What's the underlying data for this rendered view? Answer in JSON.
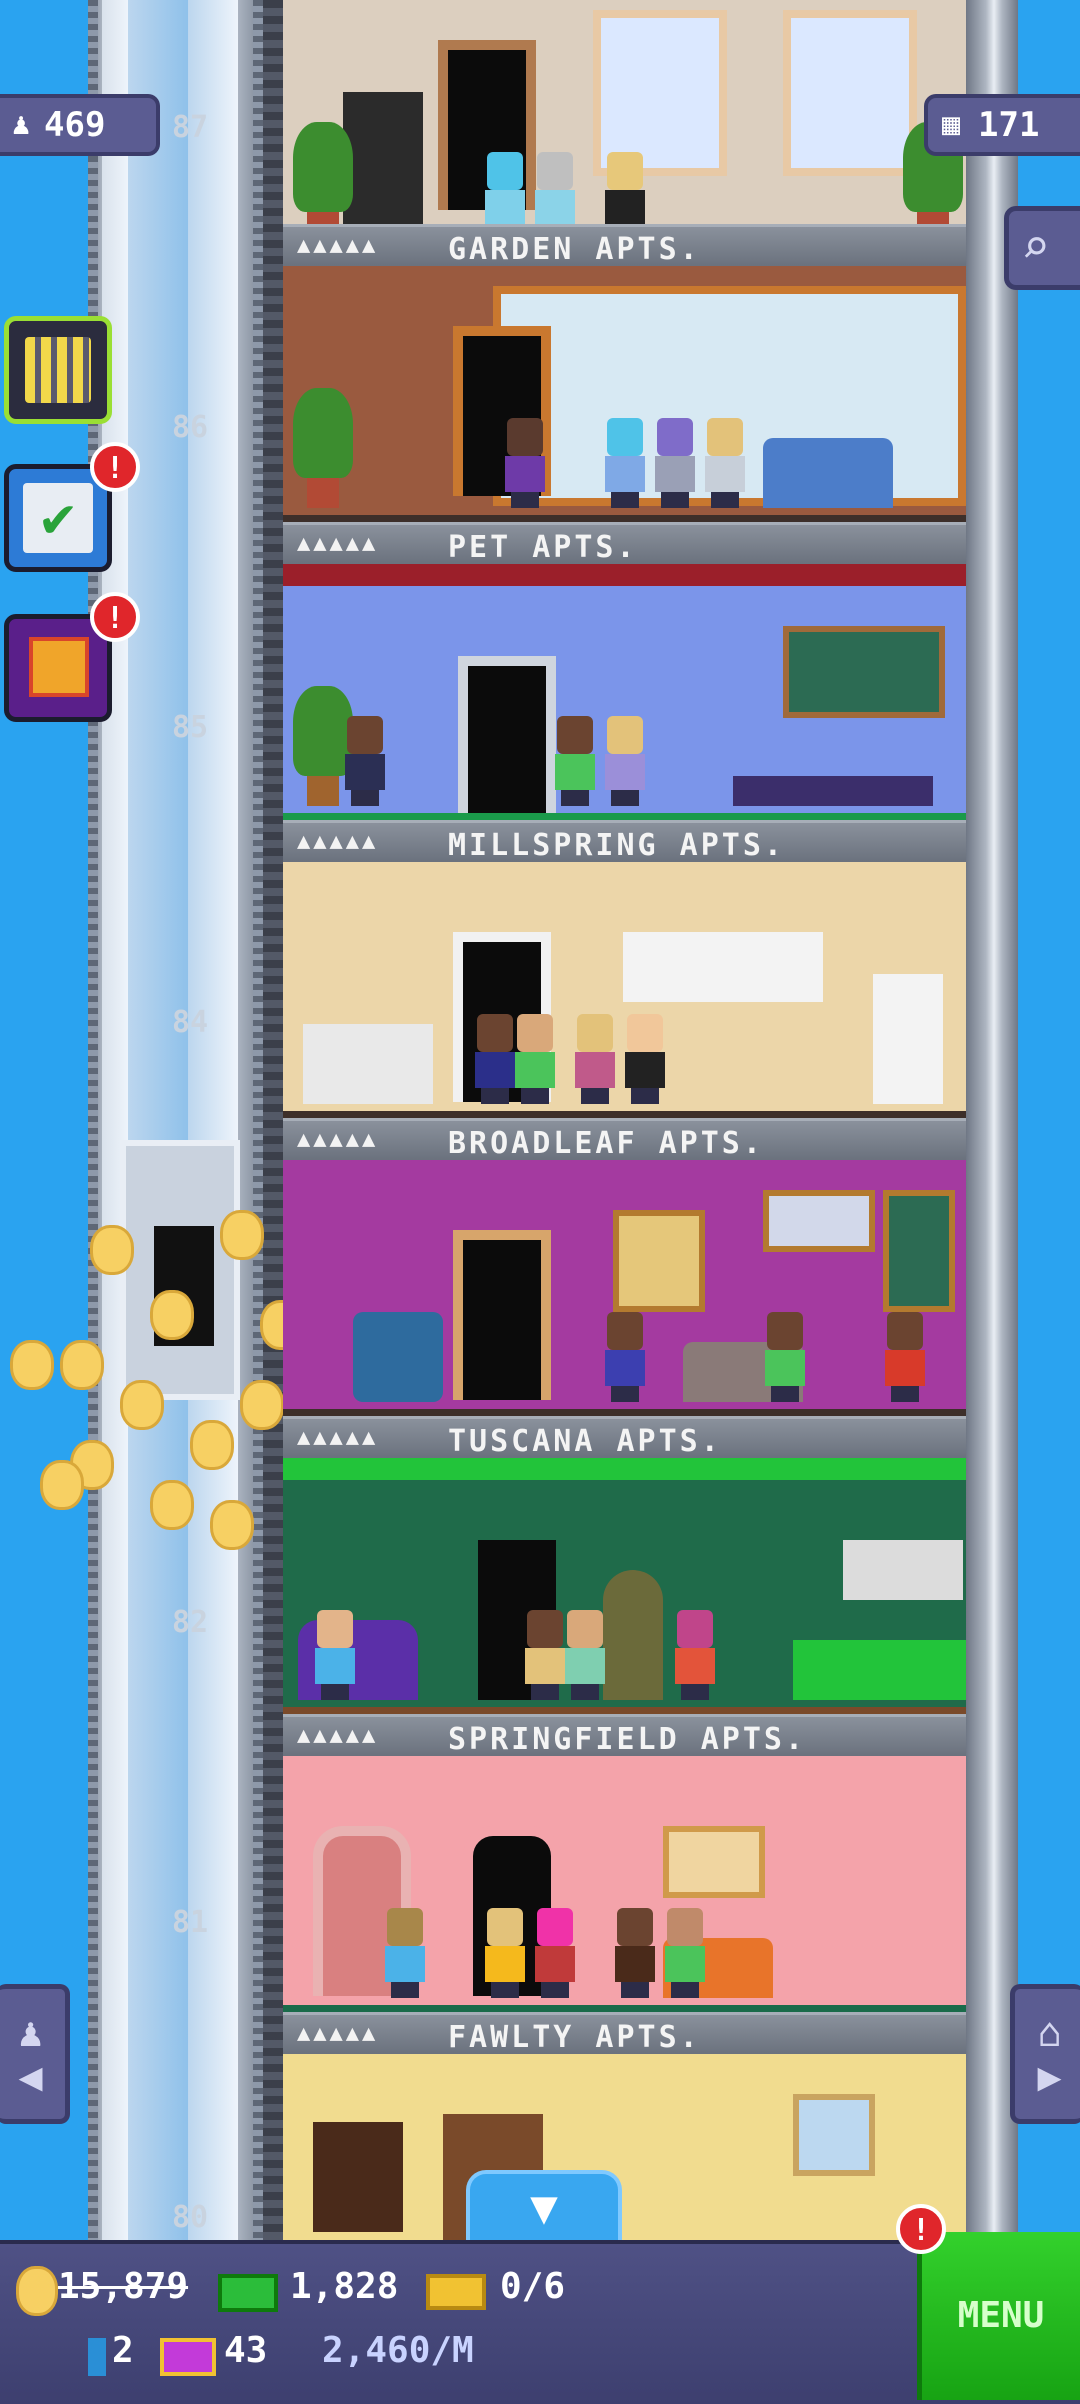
{
  "hud": {
    "population": "469",
    "floors": "171",
    "coins": "15,879",
    "bux": "1,828",
    "tickets": "0/6",
    "golden_tickets": "2",
    "vip": "43",
    "income_rate": "2,460/M",
    "menu_label": "MENU",
    "alert_mark": "!"
  },
  "floors": [
    {
      "number": "87",
      "name": "GARDEN APTS.",
      "stars": "▲▲▲▲▲",
      "wall_color": "#d8c9b8"
    },
    {
      "number": "86",
      "name": "PET APTS.",
      "stars": "▲▲▲▲▲",
      "wall_color": "#9b5a3f"
    },
    {
      "number": "85",
      "name": "MILLSPRING APTS.",
      "stars": "▲▲▲▲▲",
      "wall_color": "#7b95ea"
    },
    {
      "number": "84",
      "name": "BROADLEAF APTS.",
      "stars": "▲▲▲▲▲",
      "wall_color": "#ecd6a9"
    },
    {
      "number": "83",
      "name": "TUSCANA APTS.",
      "stars": "▲▲▲▲▲",
      "wall_color": "#a43aa0"
    },
    {
      "number": "82",
      "name": "SPRINGFIELD APTS.",
      "stars": "▲▲▲▲▲",
      "wall_color": "#1f6b4a"
    },
    {
      "number": "81",
      "name": "FAWLTY APTS.",
      "stars": "▲▲▲▲▲",
      "wall_color": "#f4a3aa"
    },
    {
      "number": "80",
      "name": "",
      "stars": "",
      "wall_color": "#f1dc8f"
    }
  ],
  "icons": {
    "population": "person-icon",
    "floors": "building-icon",
    "search": "magnifier-icon",
    "build": "building-grid-icon",
    "missions": "checklist-icon",
    "gift": "gift-icon",
    "elevator_rider": "person-arrow-icon",
    "home": "home-arrow-icon",
    "down": "down-arrow-icon"
  }
}
